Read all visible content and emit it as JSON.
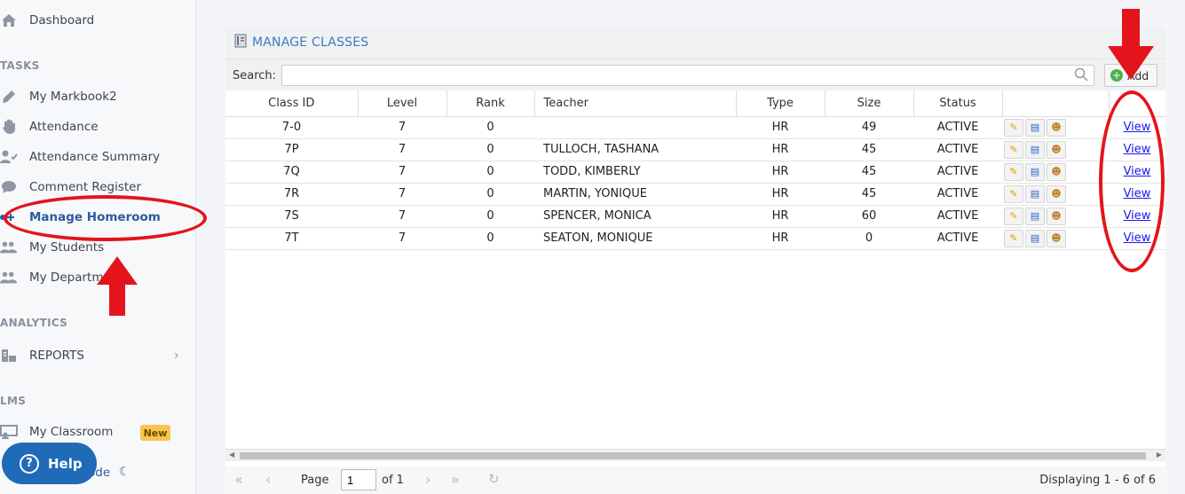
{
  "sidebar": {
    "items": [
      {
        "label": "Dashboard",
        "icon": "home-icon"
      },
      {
        "label": "My Markbook2",
        "icon": "pencil-icon"
      },
      {
        "label": "Attendance",
        "icon": "hand-icon"
      },
      {
        "label": "Attendance Summary",
        "icon": "user-check-icon"
      },
      {
        "label": "Comment Register",
        "icon": "comment-icon"
      },
      {
        "label": "Manage Homeroom",
        "icon": "user-plus-icon"
      },
      {
        "label": "My Students",
        "icon": "users-icon"
      },
      {
        "label": "My Departm",
        "icon": "users-icon"
      },
      {
        "label": "REPORTS",
        "icon": "report-icon"
      },
      {
        "label": "My Classroom",
        "icon": "classroom-icon"
      }
    ],
    "sections": {
      "tasks": "TASKS",
      "analytics": "ANALYTICS",
      "lms": "LMS"
    },
    "badge_new": "New",
    "help_label": "Help",
    "mode_label_tail": "ode"
  },
  "panel": {
    "title": "MANAGE CLASSES",
    "search_label": "Search:",
    "search_value": "",
    "add_label": "Add",
    "columns": [
      "Class ID",
      "Level",
      "Rank",
      "Teacher",
      "Type",
      "Size",
      "Status",
      "",
      ""
    ],
    "rows": [
      {
        "class_id": "7-0",
        "level": "7",
        "rank": "0",
        "teacher": "",
        "type": "HR",
        "size": "49",
        "status": "ACTIVE",
        "view": "View"
      },
      {
        "class_id": "7P",
        "level": "7",
        "rank": "0",
        "teacher": "TULLOCH, TASHANA",
        "type": "HR",
        "size": "45",
        "status": "ACTIVE",
        "view": "View"
      },
      {
        "class_id": "7Q",
        "level": "7",
        "rank": "0",
        "teacher": "TODD, KIMBERLY",
        "type": "HR",
        "size": "45",
        "status": "ACTIVE",
        "view": "View"
      },
      {
        "class_id": "7R",
        "level": "7",
        "rank": "0",
        "teacher": "MARTIN, YONIQUE",
        "type": "HR",
        "size": "45",
        "status": "ACTIVE",
        "view": "View"
      },
      {
        "class_id": "7S",
        "level": "7",
        "rank": "0",
        "teacher": "SPENCER, MONICA",
        "type": "HR",
        "size": "60",
        "status": "ACTIVE",
        "view": "View"
      },
      {
        "class_id": "7T",
        "level": "7",
        "rank": "0",
        "teacher": "SEATON, MONIQUE",
        "type": "HR",
        "size": "0",
        "status": "ACTIVE",
        "view": "View"
      }
    ]
  },
  "pager": {
    "page_label": "Page",
    "page_value": "1",
    "of_label": "of 1",
    "display_text": "Displaying 1 - 6 of 6"
  },
  "colors": {
    "accent": "#2d5aa0",
    "title_blue": "#3b7bc4",
    "annotation_red": "#e4141c"
  }
}
